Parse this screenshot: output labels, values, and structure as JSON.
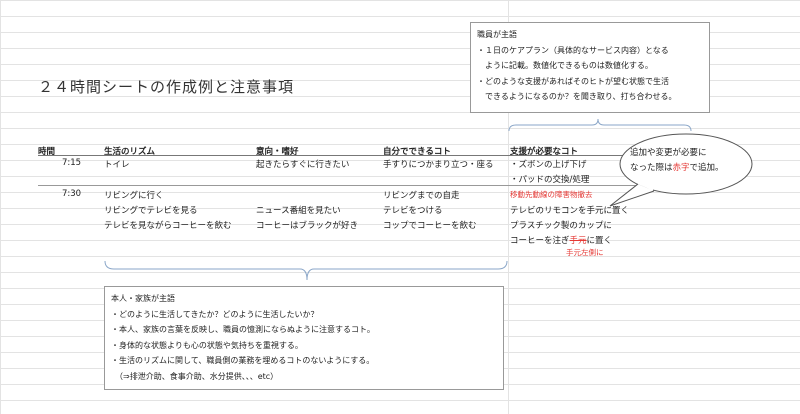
{
  "title": "２４時間シートの作成例と注意事項",
  "headers": {
    "time": "時間",
    "rhythm": "生活のリズム",
    "wish": "意向・嗜好",
    "self": "自分でできるコト",
    "support": "支援が必要なコト"
  },
  "rows": {
    "r1": {
      "time": "7:15",
      "rhythm": "トイレ",
      "wish": "起きたらすぐに行きたい",
      "self": "手すりにつかまり立つ・座る",
      "support1": "・ズボンの上げ下げ",
      "support2": "・パッドの交換/処理"
    },
    "r2": {
      "time": "7:30",
      "rhythm": [
        "リビングに行く",
        "リビングでテレビを見る",
        "テレビを見ながらコーヒーを飲む"
      ],
      "wish": [
        "ニュース番組を見たい",
        "コーヒーはブラックが好き"
      ],
      "self": [
        "リビングまでの自走",
        "テレビをつける",
        "コップでコーヒーを飲む"
      ],
      "support_red": "移動先動線の障害物撤去",
      "support": [
        "テレビのリモコンを手元に置く",
        "プラスチック製のカップに",
        "コーヒーを注ぎ",
        "に置く"
      ],
      "support_struck": "手元",
      "support_note": "手元左側に"
    }
  },
  "staff_note": {
    "lines": [
      "職員が主語",
      "・１日のケアプラン（具体的なサービス内容）となる",
      "　ように記載。数値化できるものは数値化する。",
      "・どのような支援があればそのヒトが望む状態で生活",
      "　できるようになるのか？を聞き取り、打ち合わせる。"
    ]
  },
  "person_note": {
    "lines": [
      "本人・家族が主語",
      "・どのように生活してきたか？どのように生活したいか？",
      "・本人、家族の言葉を反映し、職員の憶測にならぬように注意するコト。",
      "・身体的な状態よりも心の状態や気持ちを重視する。",
      "・生活のリズムに関して、職員側の業務を埋めるコトのないようにする。",
      "　（⇒排泄介助、食事介助、水分提供、、、etc）"
    ]
  },
  "bubble": {
    "line1": "追加や変更が必要に",
    "line2_pre": "なった際は",
    "line2_red": "赤字",
    "line2_post": "で追加。"
  },
  "colors": {
    "accent_red": "#e53935",
    "bracket_blue": "#8aa6c8"
  }
}
